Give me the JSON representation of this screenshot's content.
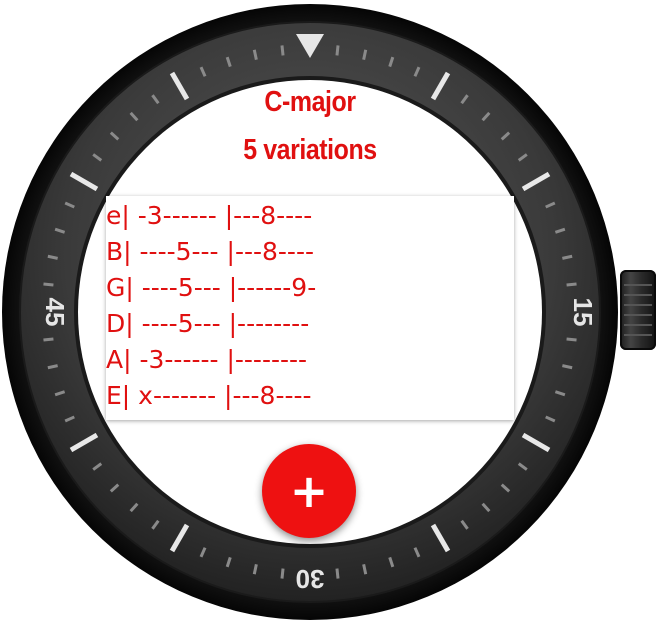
{
  "screen": {
    "title_line1": "C-major",
    "title_line2": "5 variations",
    "accent_color": "#e01010"
  },
  "tab": {
    "rows": [
      {
        "string": "e",
        "text": "e| -3------ |---8----"
      },
      {
        "string": "B",
        "text": "B| ----5--- |---8----"
      },
      {
        "string": "G",
        "text": "G| ----5--- |------9-"
      },
      {
        "string": "D",
        "text": "D| ----5--- |--------"
      },
      {
        "string": "A",
        "text": "A| -3------ |--------"
      },
      {
        "string": "E",
        "text": "E| x------- |---8----"
      }
    ]
  },
  "bezel": {
    "label_15": "15",
    "label_30": "30",
    "label_45": "45",
    "marker_top": "triangle-marker"
  },
  "fab": {
    "icon": "plus-icon",
    "color": "#ee1111"
  },
  "crown": {
    "icon": "crown-button"
  }
}
